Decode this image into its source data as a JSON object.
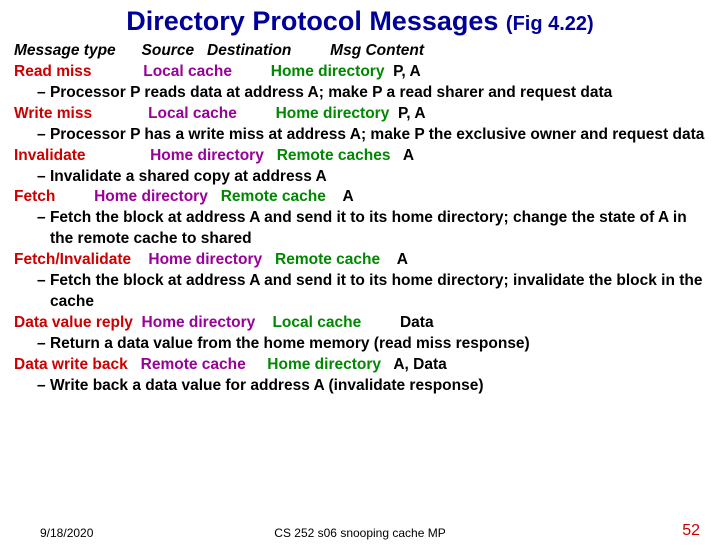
{
  "title_main": "Directory Protocol Messages",
  "title_fig": "(Fig 4.22)",
  "header": {
    "c0": "Message type",
    "c1": "Source",
    "c2": "Destination",
    "c3": "Msg Content"
  },
  "rows": [
    {
      "type": "Read miss",
      "src": "Local cache",
      "dst": "Home directory",
      "msg": "P, A",
      "desc": "Processor P reads data at address A; make P a read sharer and request data"
    },
    {
      "type": "Write miss",
      "src": "Local cache",
      "dst": "Home directory",
      "msg": "P, A",
      "desc": "Processor P has a write miss at address A; make P the exclusive owner and request data"
    },
    {
      "type": "Invalidate",
      "src": "Home directory",
      "dst": "Remote caches",
      "msg": "A",
      "desc": "Invalidate a shared copy at address A"
    },
    {
      "type": "Fetch",
      "src": "Home directory",
      "dst": "Remote cache",
      "msg": "A",
      "desc": "Fetch the block at address A and send it to its home directory; change the state of A in the remote cache to shared"
    },
    {
      "type": "Fetch/Invalidate",
      "src": "Home directory",
      "dst": "Remote cache",
      "msg": "A",
      "desc": "Fetch the block at address A and send it to its home directory; invalidate the block in the cache"
    },
    {
      "type": "Data value reply",
      "src": "Home directory",
      "dst": "Local cache",
      "msg": "Data",
      "desc": "Return a data value from the home memory (read miss response)"
    },
    {
      "type": "Data write back",
      "src": "Remote cache",
      "dst": "Home directory",
      "msg": "A, Data",
      "desc": "Write back a data value for address A (invalidate response)"
    }
  ],
  "footer": {
    "date": "9/18/2020",
    "mid": "CS 252 s06 snooping cache MP",
    "num": "52"
  }
}
